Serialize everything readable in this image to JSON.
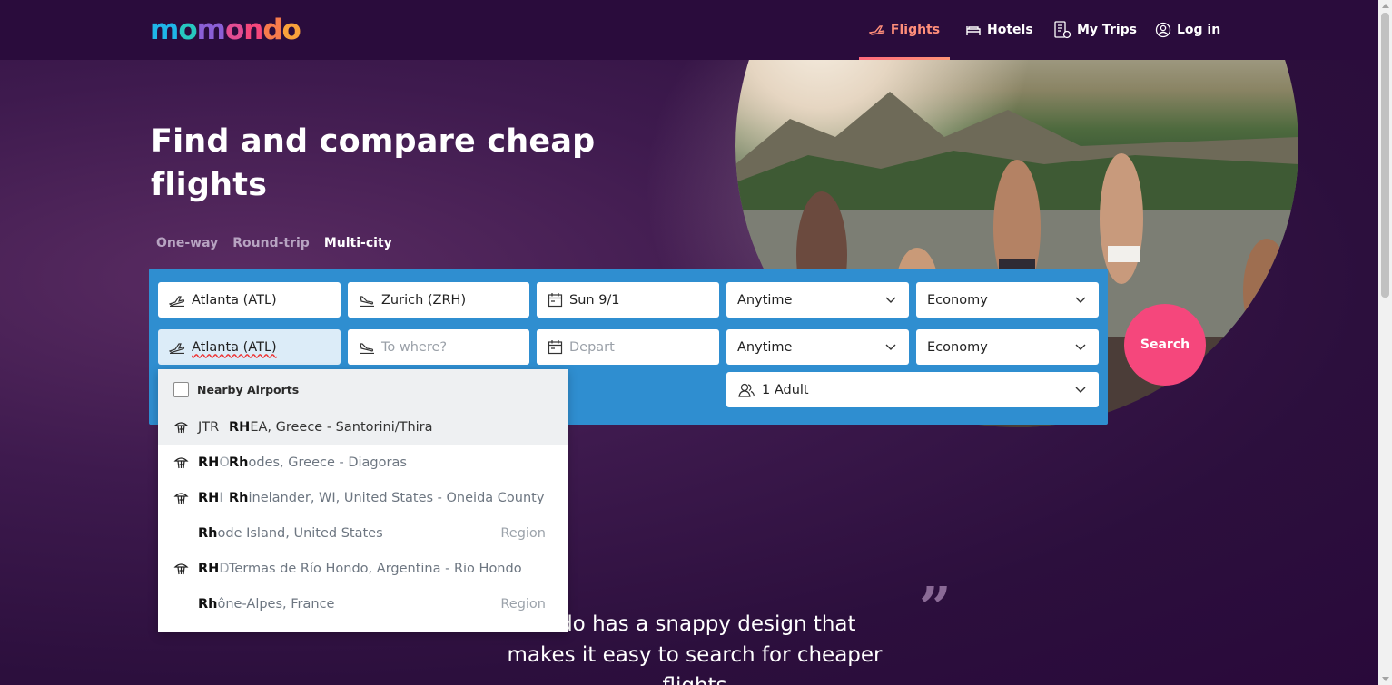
{
  "header": {
    "logo_letters": [
      "m",
      "o",
      "m",
      "o",
      "n",
      "d",
      "o"
    ],
    "logo_colors": [
      "#1fb6e8",
      "#27c8c0",
      "#8b5fd6",
      "#e24d92",
      "#f5477c",
      "#f77b4c",
      "#f8a13b"
    ],
    "nav": {
      "flights": "Flights",
      "hotels": "Hotels",
      "my_trips": "My Trips",
      "login": "Log in"
    }
  },
  "hero": {
    "title": "Find and compare cheap flights",
    "trip_types": [
      "One-way",
      "Round-trip",
      "Multi-city"
    ],
    "active_trip_type": "Multi-city"
  },
  "form": {
    "row1": {
      "from": "Atlanta (ATL)",
      "to": "Zurich (ZRH)",
      "date": "Sun 9/1",
      "time": "Anytime",
      "cabin": "Economy"
    },
    "row2": {
      "from": "Atlanta (ATL)",
      "to_placeholder": "To where?",
      "date_placeholder": "Depart",
      "time": "Anytime",
      "cabin": "Economy"
    },
    "travelers": "1 Adult",
    "search_label": "Search"
  },
  "dropdown": {
    "nearby_label": "Nearby Airports",
    "items": [
      {
        "code_bold": "",
        "code_rest": "JTR",
        "name_bold": "RH",
        "name_rest": "EA, Greece - Santorini/Thira",
        "region": "",
        "icon": true
      },
      {
        "code_bold": "RH",
        "code_rest": "O",
        "name_bold": "Rh",
        "name_rest": "odes, Greece - Diagoras",
        "region": "",
        "icon": true
      },
      {
        "code_bold": "RH",
        "code_rest": "I",
        "name_bold": "Rh",
        "name_rest": "inelander, WI, United States - Oneida County",
        "region": "",
        "icon": true
      },
      {
        "code_bold": "",
        "code_rest": "",
        "name_bold": "Rh",
        "name_rest": "ode Island, United States",
        "region": "Region",
        "icon": false
      },
      {
        "code_bold": "RH",
        "code_rest": "D",
        "name_bold": "",
        "name_rest": "Termas de Río Hondo, Argentina - Rio Hondo",
        "region": "",
        "icon": true
      },
      {
        "code_bold": "",
        "code_rest": "",
        "name_bold": "Rh",
        "name_rest": "ône-Alpes, France",
        "region": "Region",
        "icon": false
      }
    ]
  },
  "quote": {
    "text": "ondo has a snappy design that makes it easy to search for cheaper flights",
    "mark": "”"
  }
}
